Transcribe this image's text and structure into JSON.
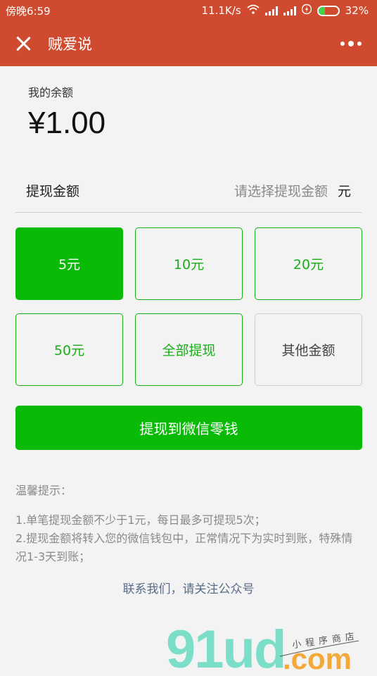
{
  "status_bar": {
    "time": "傍晚6:59",
    "speed": "11.1K/s",
    "battery": "32%",
    "battery_level": 0.32,
    "icons": [
      "wifi-icon",
      "signal-icon",
      "signal-icon",
      "charging-icon",
      "battery-icon"
    ]
  },
  "header": {
    "title": "贼爱说",
    "close_icon": "close-icon",
    "more_icon": "more-icon",
    "background": "#cf4a2e"
  },
  "balance": {
    "label": "我的余额",
    "amount": "¥1.00"
  },
  "withdraw": {
    "label": "提现金额",
    "placeholder": "请选择提现金额",
    "unit": "元"
  },
  "options": [
    {
      "label": "5元",
      "selected": true
    },
    {
      "label": "10元",
      "selected": false
    },
    {
      "label": "20元",
      "selected": false
    },
    {
      "label": "50元",
      "selected": false
    },
    {
      "label": "全部提现",
      "selected": false
    },
    {
      "label": "其他金额",
      "selected": false
    }
  ],
  "primary_button": {
    "label": "提现到微信零钱",
    "color": "#09bb07"
  },
  "tips": {
    "title": "温馨提示：",
    "line1": "1.单笔提现金额不少于1元，每日最多可提现5次；",
    "line2": "2.提现金额将转入您的微信钱包中，正常情况下为实时到账，特殊情况1-3天到账；"
  },
  "contact": "联系我们，请关注公众号",
  "watermark": {
    "logo": "91ud",
    "suffix": ".com",
    "tagline": "小程序商店"
  }
}
